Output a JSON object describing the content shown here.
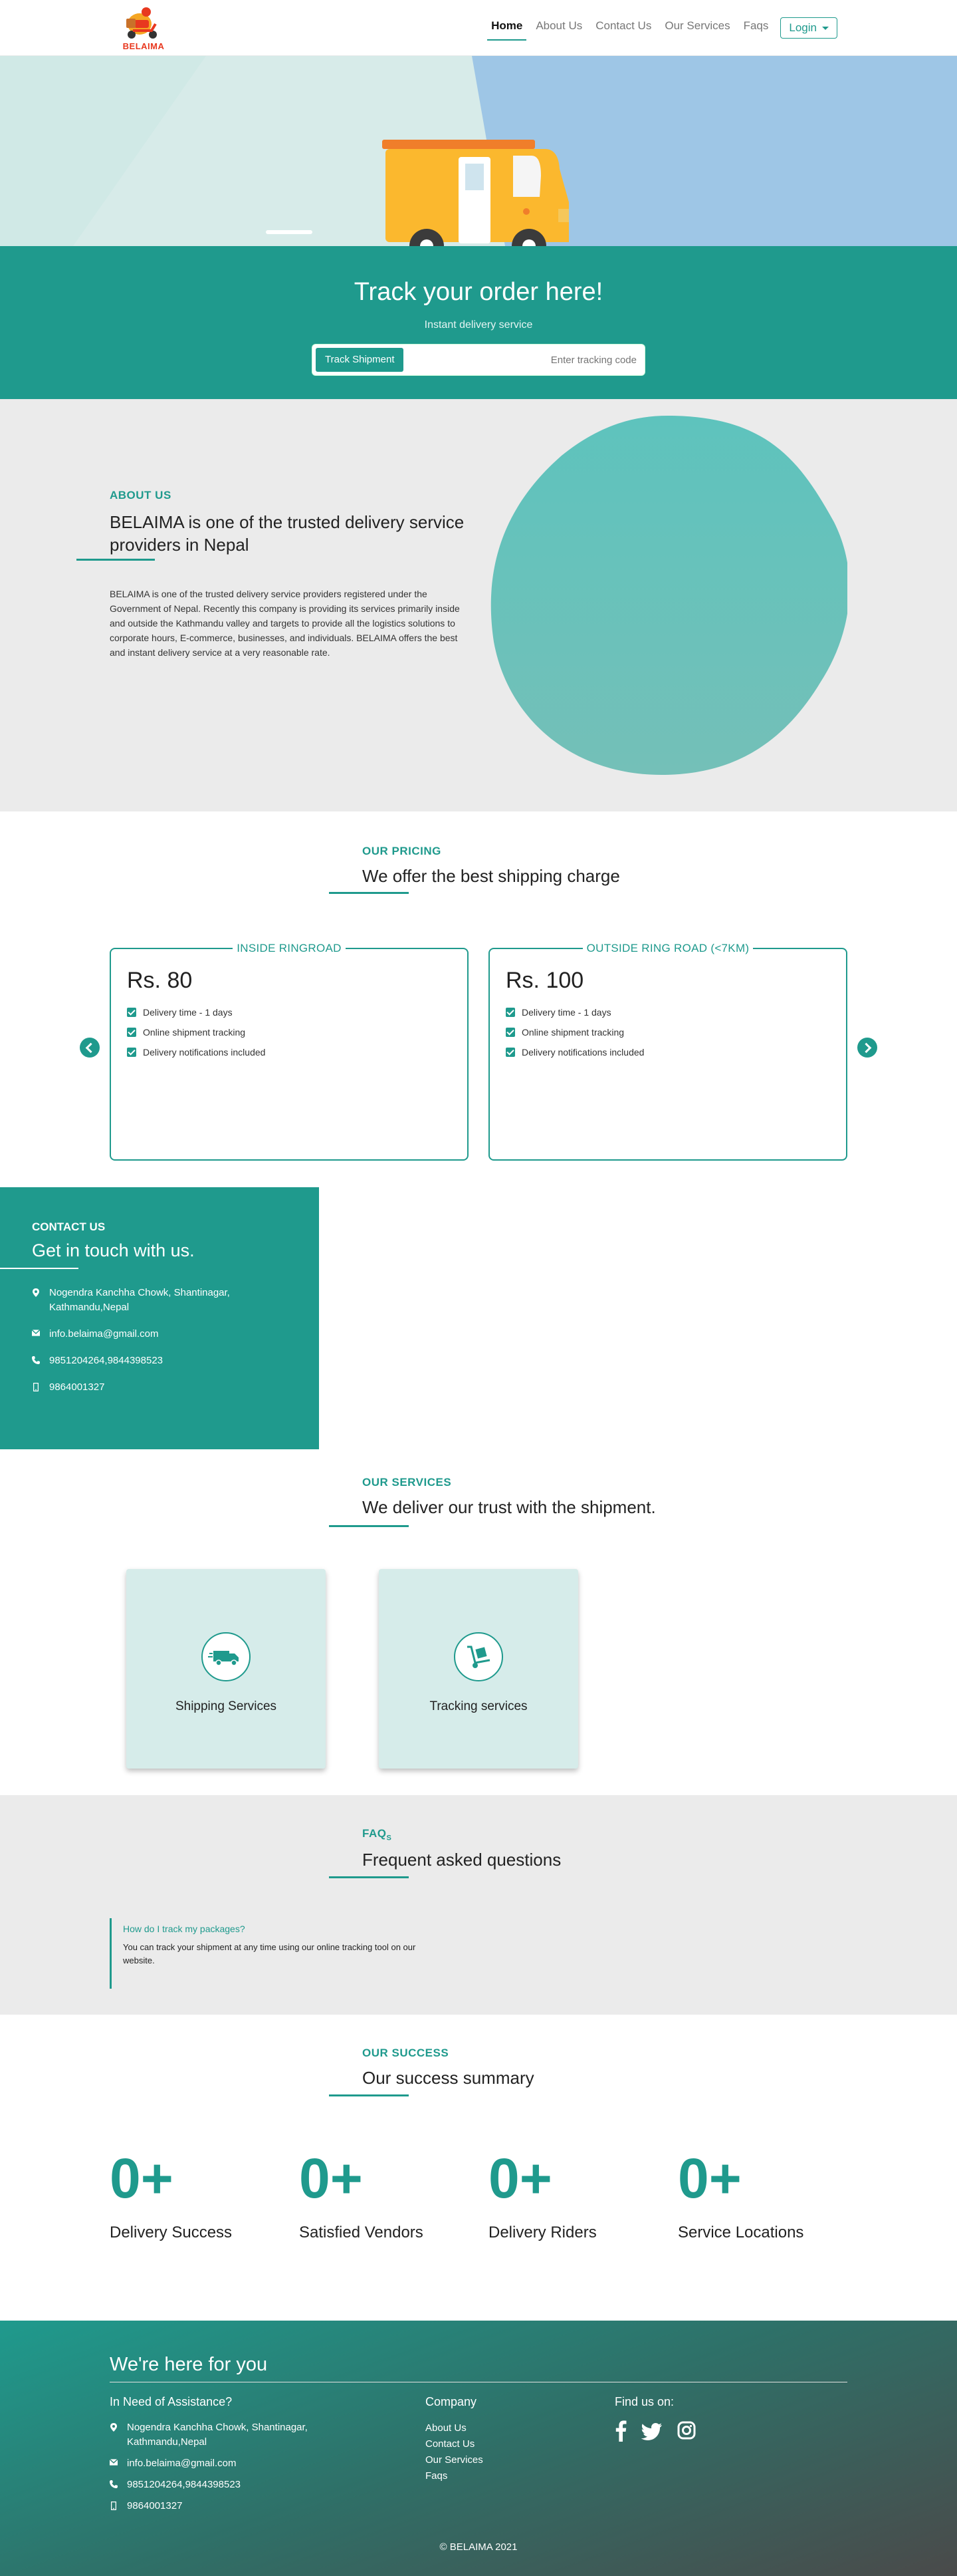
{
  "brand": {
    "name": "BELAIMA",
    "accent": "#1f9a8d"
  },
  "nav": {
    "items": [
      {
        "label": "Home",
        "active": true
      },
      {
        "label": "About Us"
      },
      {
        "label": "Contact Us"
      },
      {
        "label": "Our Services"
      },
      {
        "label": "Faqs"
      }
    ],
    "login": "Login"
  },
  "hero": {
    "title": "Track your order here!",
    "subtitle": "Instant delivery service",
    "track_button": "Track Shipment",
    "track_placeholder": "Enter tracking code"
  },
  "about": {
    "label": "ABOUT US",
    "title": "BELAIMA is one of the trusted delivery service providers in  Nepal",
    "text": "BELAIMA is one of the trusted delivery service providers registered under the Government of Nepal. Recently this company is providing its services primarily inside and outside the Kathmandu valley and targets to provide all the logistics solutions to corporate hours, E-commerce, businesses, and individuals. BELAIMA offers the best and instant delivery service at a very reasonable rate."
  },
  "pricing": {
    "label": "OUR PRICING",
    "title": "We offer the best shipping charge",
    "cards": [
      {
        "tag": "INSIDE RINGROAD",
        "price": "Rs. 80",
        "features": [
          "Delivery time - 1 days",
          "Online shipment tracking",
          "Delivery notifications included"
        ]
      },
      {
        "tag": "OUTSIDE RING ROAD (<7KM)",
        "price": "Rs. 100",
        "features": [
          "Delivery time - 1 days",
          "Online shipment tracking",
          "Delivery notifications included"
        ]
      }
    ]
  },
  "contact": {
    "label": "CONTACT US",
    "title": "Get in touch with us.",
    "address": "Nogendra Kanchha Chowk, Shantinagar, Kathmandu,Nepal",
    "email": "info.belaima@gmail.com",
    "phone": "9851204264,9844398523",
    "mobile": "9864001327"
  },
  "services": {
    "label": "OUR SERVICES",
    "title": "We deliver our trust with the shipment.",
    "items": [
      {
        "name": "Shipping Services",
        "icon": "truck-icon"
      },
      {
        "name": "Tracking services",
        "icon": "dolly-icon"
      }
    ]
  },
  "faq": {
    "label": "FAQ",
    "label_suffix": "S",
    "title": "Frequent asked questions",
    "items": [
      {
        "q": "How do I track my packages?",
        "a": "You can track your shipment at any time using our online tracking tool on our website."
      }
    ]
  },
  "success": {
    "label": "OUR SUCCESS",
    "title": "Our success summary",
    "stats": [
      {
        "value": "0+",
        "label": "Delivery Success"
      },
      {
        "value": "0+",
        "label": "Satisfied Vendors"
      },
      {
        "value": "0+",
        "label": "Delivery Riders"
      },
      {
        "value": "0+",
        "label": "Service Locations"
      }
    ]
  },
  "footer": {
    "title": "We're here for you",
    "assist_head": "In Need of Assistance?",
    "address": "Nogendra Kanchha Chowk, Shantinagar, Kathmandu,Nepal",
    "email": "info.belaima@gmail.com",
    "phone": "9851204264,9844398523",
    "mobile": "9864001327",
    "company_head": "Company",
    "links": [
      "About Us",
      "Contact Us",
      "Our Services",
      "Faqs"
    ],
    "social_head": "Find us on:",
    "copyright": "© BELAIMA 2021"
  }
}
